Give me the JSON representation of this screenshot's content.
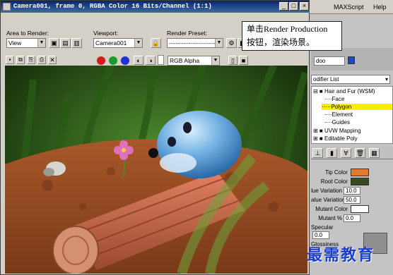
{
  "background_max": {
    "menu_maxscript": "MAXScript",
    "menu_help": "Help",
    "modifier_list": "odifier List",
    "stack": [
      "Hair and Fur (WSM)",
      "Face",
      "Polygon",
      "Element",
      "Guides",
      "UVW Mapping",
      "Editable Poly"
    ],
    "stack_selected": "Polygon",
    "params": {
      "tip_color_label": "Tip Color",
      "root_color_label": "Root Color",
      "hue_variation_label": "lue Variation",
      "hue_variation_value": "10.0",
      "value_variation_label": "alue Variation",
      "value_variation_value": "50.0",
      "mutant_color_label": "Mutant Color",
      "mutant_pct_label": "Mutant %",
      "mutant_pct_value": "0.0",
      "specular_label": "Specular",
      "specular_value": "0.0",
      "glossiness_label": "Glossiness"
    },
    "colors": {
      "tip": "#e07a2e",
      "root": "#3b4a1c",
      "mutant": "#ffffff"
    }
  },
  "render_window": {
    "title": "Camera001, frame 0, RGBA Color 16 Bits/Channel (1:1)",
    "area_label": "Area to Render:",
    "area_value": "View",
    "viewport_label": "Viewport:",
    "viewport_value": "Camera001",
    "preset_label": "Render Preset:",
    "preset_value": "----------------------------",
    "channel_value": "RGB Alpha",
    "channel_colors": {
      "red": "#d41c1c",
      "green": "#1c9a2c",
      "blue": "#2430d0"
    }
  },
  "callout": {
    "line1": "单击Render Production",
    "line2": "按钮，渲染场景。"
  },
  "watermark": "最需教育"
}
